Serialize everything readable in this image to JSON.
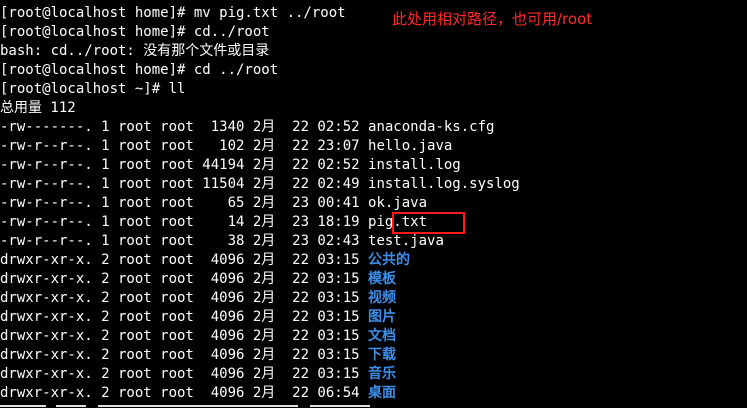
{
  "terminal": {
    "lines": [
      "[root@localhost home]# mv pig.txt ../root",
      "[root@localhost home]# cd../root",
      "bash: cd../root: 没有那个文件或目录",
      "[root@localhost home]# cd ../root",
      "[root@localhost ~]# ll",
      "总用量 112"
    ],
    "files": [
      {
        "meta": "-rw-------. 1 root root  1340 2月  22 02:52 ",
        "name": "anaconda-ks.cfg"
      },
      {
        "meta": "-rw-r--r--. 1 root root   102 2月  22 23:07 ",
        "name": "hello.java"
      },
      {
        "meta": "-rw-r--r--. 1 root root 44194 2月  22 02:52 ",
        "name": "install.log"
      },
      {
        "meta": "-rw-r--r--. 1 root root 11504 2月  22 02:49 ",
        "name": "install.log.syslog"
      },
      {
        "meta": "-rw-r--r--. 1 root root    65 2月  23 00:41 ",
        "name": "ok.java"
      },
      {
        "meta": "-rw-r--r--. 1 root root    14 2月  23 18:19 ",
        "name": "pig.txt"
      },
      {
        "meta": "-rw-r--r--. 1 root root    38 2月  23 02:43 ",
        "name": "test.java"
      }
    ],
    "dirs": [
      {
        "meta": "drwxr-xr-x. 2 root root  4096 2月  22 03:15 ",
        "name": "公共的"
      },
      {
        "meta": "drwxr-xr-x. 2 root root  4096 2月  22 03:15 ",
        "name": "模板"
      },
      {
        "meta": "drwxr-xr-x. 2 root root  4096 2月  22 03:15 ",
        "name": "视频"
      },
      {
        "meta": "drwxr-xr-x. 2 root root  4096 2月  22 03:15 ",
        "name": "图片"
      },
      {
        "meta": "drwxr-xr-x. 2 root root  4096 2月  22 03:15 ",
        "name": "文档"
      },
      {
        "meta": "drwxr-xr-x. 2 root root  4096 2月  22 03:15 ",
        "name": "下载"
      },
      {
        "meta": "drwxr-xr-x. 2 root root  4096 2月  22 03:15 ",
        "name": "音乐"
      },
      {
        "meta": "drwxr-xr-x. 2 root root  4096 2月  22 06:54 ",
        "name": "桌面"
      }
    ]
  },
  "annotation": {
    "text": "此处用相对路径，也可用/root"
  },
  "colors": {
    "background": "#000000",
    "text": "#ffffff",
    "directory": "#3b8eea",
    "annotation": "#ff2a2a"
  }
}
